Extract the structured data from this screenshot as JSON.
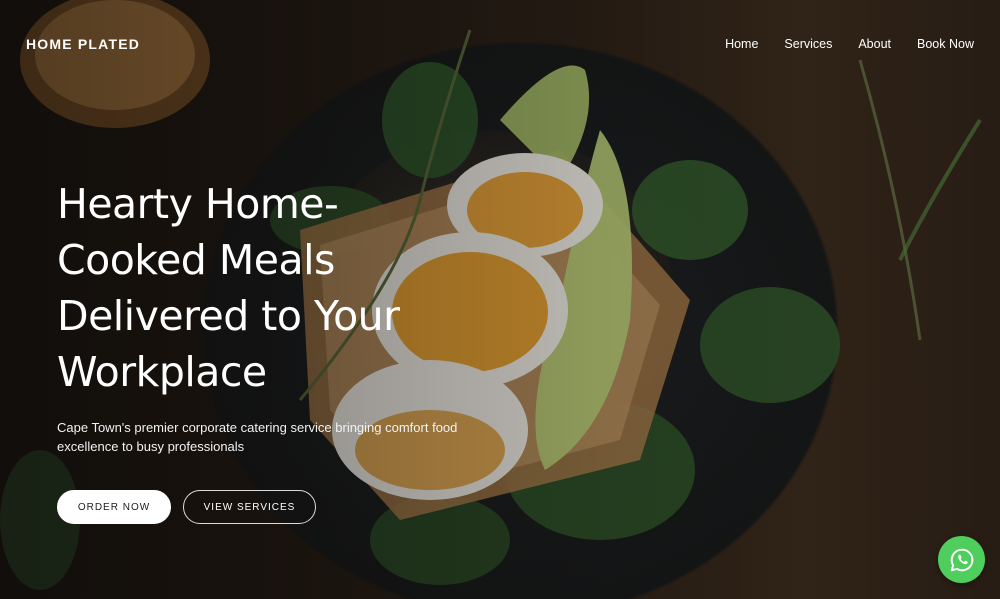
{
  "header": {
    "logo": "HOME PLATED",
    "nav": [
      {
        "label": "Home"
      },
      {
        "label": "Services"
      },
      {
        "label": "About"
      },
      {
        "label": "Book Now"
      }
    ]
  },
  "hero": {
    "title_lines": [
      "Hearty Home-",
      "Cooked Meals",
      "Delivered to Your",
      "Workplace"
    ],
    "subtitle": "Cape Town's premier corporate catering service bringing comfort food excellence to busy professionals",
    "primary_button": "ORDER NOW",
    "secondary_button": "VIEW SERVICES"
  },
  "floating": {
    "whatsapp_icon": "whatsapp-icon"
  },
  "colors": {
    "whatsapp_green": "#4fce5d",
    "primary_button_bg": "#ffffff"
  }
}
